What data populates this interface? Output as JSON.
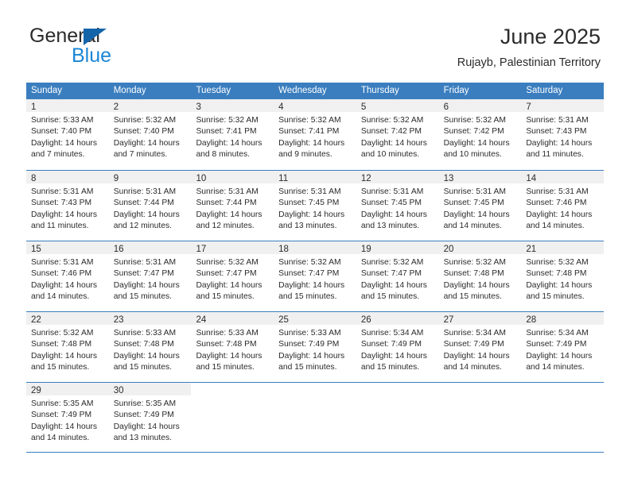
{
  "brand": {
    "name_part1": "General",
    "name_part2": "Blue",
    "triangle_color": "#1464aa",
    "blue_color": "#1a86d6"
  },
  "header": {
    "title": "June 2025",
    "location": "Rujayb, Palestinian Territory"
  },
  "theme": {
    "header_blue": "#3a7ebf",
    "day_band_gray": "#f0f0f0",
    "text_color": "#2b2b2b"
  },
  "weekdays": [
    "Sunday",
    "Monday",
    "Tuesday",
    "Wednesday",
    "Thursday",
    "Friday",
    "Saturday"
  ],
  "weeks": [
    [
      {
        "day": "1",
        "sunrise": "Sunrise: 5:33 AM",
        "sunset": "Sunset: 7:40 PM",
        "daylight1": "Daylight: 14 hours",
        "daylight2": "and 7 minutes."
      },
      {
        "day": "2",
        "sunrise": "Sunrise: 5:32 AM",
        "sunset": "Sunset: 7:40 PM",
        "daylight1": "Daylight: 14 hours",
        "daylight2": "and 7 minutes."
      },
      {
        "day": "3",
        "sunrise": "Sunrise: 5:32 AM",
        "sunset": "Sunset: 7:41 PM",
        "daylight1": "Daylight: 14 hours",
        "daylight2": "and 8 minutes."
      },
      {
        "day": "4",
        "sunrise": "Sunrise: 5:32 AM",
        "sunset": "Sunset: 7:41 PM",
        "daylight1": "Daylight: 14 hours",
        "daylight2": "and 9 minutes."
      },
      {
        "day": "5",
        "sunrise": "Sunrise: 5:32 AM",
        "sunset": "Sunset: 7:42 PM",
        "daylight1": "Daylight: 14 hours",
        "daylight2": "and 10 minutes."
      },
      {
        "day": "6",
        "sunrise": "Sunrise: 5:32 AM",
        "sunset": "Sunset: 7:42 PM",
        "daylight1": "Daylight: 14 hours",
        "daylight2": "and 10 minutes."
      },
      {
        "day": "7",
        "sunrise": "Sunrise: 5:31 AM",
        "sunset": "Sunset: 7:43 PM",
        "daylight1": "Daylight: 14 hours",
        "daylight2": "and 11 minutes."
      }
    ],
    [
      {
        "day": "8",
        "sunrise": "Sunrise: 5:31 AM",
        "sunset": "Sunset: 7:43 PM",
        "daylight1": "Daylight: 14 hours",
        "daylight2": "and 11 minutes."
      },
      {
        "day": "9",
        "sunrise": "Sunrise: 5:31 AM",
        "sunset": "Sunset: 7:44 PM",
        "daylight1": "Daylight: 14 hours",
        "daylight2": "and 12 minutes."
      },
      {
        "day": "10",
        "sunrise": "Sunrise: 5:31 AM",
        "sunset": "Sunset: 7:44 PM",
        "daylight1": "Daylight: 14 hours",
        "daylight2": "and 12 minutes."
      },
      {
        "day": "11",
        "sunrise": "Sunrise: 5:31 AM",
        "sunset": "Sunset: 7:45 PM",
        "daylight1": "Daylight: 14 hours",
        "daylight2": "and 13 minutes."
      },
      {
        "day": "12",
        "sunrise": "Sunrise: 5:31 AM",
        "sunset": "Sunset: 7:45 PM",
        "daylight1": "Daylight: 14 hours",
        "daylight2": "and 13 minutes."
      },
      {
        "day": "13",
        "sunrise": "Sunrise: 5:31 AM",
        "sunset": "Sunset: 7:45 PM",
        "daylight1": "Daylight: 14 hours",
        "daylight2": "and 14 minutes."
      },
      {
        "day": "14",
        "sunrise": "Sunrise: 5:31 AM",
        "sunset": "Sunset: 7:46 PM",
        "daylight1": "Daylight: 14 hours",
        "daylight2": "and 14 minutes."
      }
    ],
    [
      {
        "day": "15",
        "sunrise": "Sunrise: 5:31 AM",
        "sunset": "Sunset: 7:46 PM",
        "daylight1": "Daylight: 14 hours",
        "daylight2": "and 14 minutes."
      },
      {
        "day": "16",
        "sunrise": "Sunrise: 5:31 AM",
        "sunset": "Sunset: 7:47 PM",
        "daylight1": "Daylight: 14 hours",
        "daylight2": "and 15 minutes."
      },
      {
        "day": "17",
        "sunrise": "Sunrise: 5:32 AM",
        "sunset": "Sunset: 7:47 PM",
        "daylight1": "Daylight: 14 hours",
        "daylight2": "and 15 minutes."
      },
      {
        "day": "18",
        "sunrise": "Sunrise: 5:32 AM",
        "sunset": "Sunset: 7:47 PM",
        "daylight1": "Daylight: 14 hours",
        "daylight2": "and 15 minutes."
      },
      {
        "day": "19",
        "sunrise": "Sunrise: 5:32 AM",
        "sunset": "Sunset: 7:47 PM",
        "daylight1": "Daylight: 14 hours",
        "daylight2": "and 15 minutes."
      },
      {
        "day": "20",
        "sunrise": "Sunrise: 5:32 AM",
        "sunset": "Sunset: 7:48 PM",
        "daylight1": "Daylight: 14 hours",
        "daylight2": "and 15 minutes."
      },
      {
        "day": "21",
        "sunrise": "Sunrise: 5:32 AM",
        "sunset": "Sunset: 7:48 PM",
        "daylight1": "Daylight: 14 hours",
        "daylight2": "and 15 minutes."
      }
    ],
    [
      {
        "day": "22",
        "sunrise": "Sunrise: 5:32 AM",
        "sunset": "Sunset: 7:48 PM",
        "daylight1": "Daylight: 14 hours",
        "daylight2": "and 15 minutes."
      },
      {
        "day": "23",
        "sunrise": "Sunrise: 5:33 AM",
        "sunset": "Sunset: 7:48 PM",
        "daylight1": "Daylight: 14 hours",
        "daylight2": "and 15 minutes."
      },
      {
        "day": "24",
        "sunrise": "Sunrise: 5:33 AM",
        "sunset": "Sunset: 7:48 PM",
        "daylight1": "Daylight: 14 hours",
        "daylight2": "and 15 minutes."
      },
      {
        "day": "25",
        "sunrise": "Sunrise: 5:33 AM",
        "sunset": "Sunset: 7:49 PM",
        "daylight1": "Daylight: 14 hours",
        "daylight2": "and 15 minutes."
      },
      {
        "day": "26",
        "sunrise": "Sunrise: 5:34 AM",
        "sunset": "Sunset: 7:49 PM",
        "daylight1": "Daylight: 14 hours",
        "daylight2": "and 15 minutes."
      },
      {
        "day": "27",
        "sunrise": "Sunrise: 5:34 AM",
        "sunset": "Sunset: 7:49 PM",
        "daylight1": "Daylight: 14 hours",
        "daylight2": "and 14 minutes."
      },
      {
        "day": "28",
        "sunrise": "Sunrise: 5:34 AM",
        "sunset": "Sunset: 7:49 PM",
        "daylight1": "Daylight: 14 hours",
        "daylight2": "and 14 minutes."
      }
    ],
    [
      {
        "day": "29",
        "sunrise": "Sunrise: 5:35 AM",
        "sunset": "Sunset: 7:49 PM",
        "daylight1": "Daylight: 14 hours",
        "daylight2": "and 14 minutes."
      },
      {
        "day": "30",
        "sunrise": "Sunrise: 5:35 AM",
        "sunset": "Sunset: 7:49 PM",
        "daylight1": "Daylight: 14 hours",
        "daylight2": "and 13 minutes."
      },
      {
        "day": "",
        "sunrise": "",
        "sunset": "",
        "daylight1": "",
        "daylight2": ""
      },
      {
        "day": "",
        "sunrise": "",
        "sunset": "",
        "daylight1": "",
        "daylight2": ""
      },
      {
        "day": "",
        "sunrise": "",
        "sunset": "",
        "daylight1": "",
        "daylight2": ""
      },
      {
        "day": "",
        "sunrise": "",
        "sunset": "",
        "daylight1": "",
        "daylight2": ""
      },
      {
        "day": "",
        "sunrise": "",
        "sunset": "",
        "daylight1": "",
        "daylight2": ""
      }
    ]
  ]
}
